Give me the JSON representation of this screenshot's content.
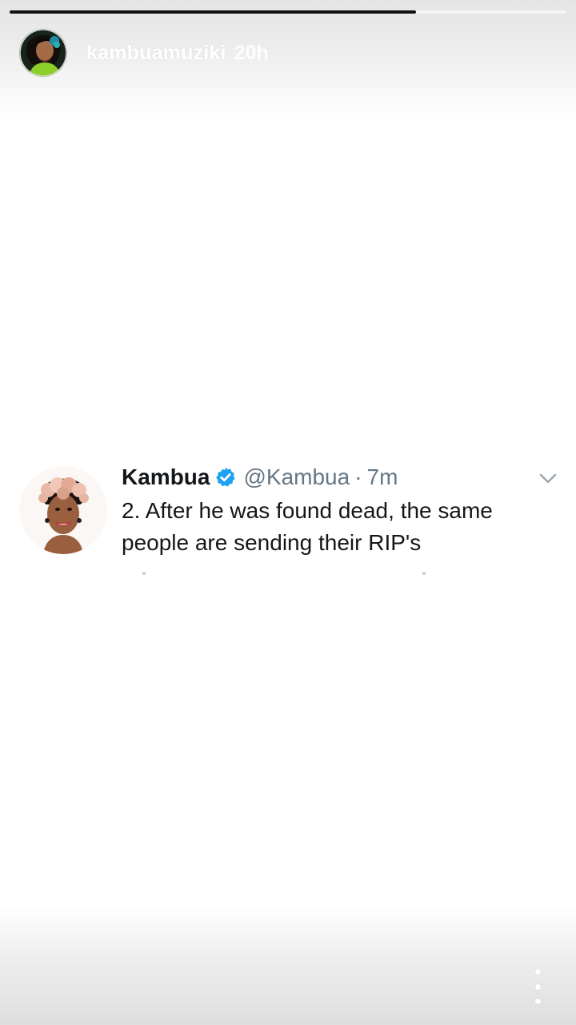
{
  "story": {
    "username": "kambuamuziki",
    "time_ago": "20h",
    "progress": 0.73,
    "more_icon": "more-vertical-icon"
  },
  "tweet": {
    "name": "Kambua",
    "handle": "@Kambua",
    "separator": "·",
    "time": "7m",
    "text": "2. After he was found dead, the same people are sending their RIP's",
    "verified_icon": "verified-badge-icon",
    "chevron_icon": "chevron-down-icon"
  },
  "colors": {
    "twitter_blue": "#1da1f2",
    "story_progress": "#111111"
  }
}
